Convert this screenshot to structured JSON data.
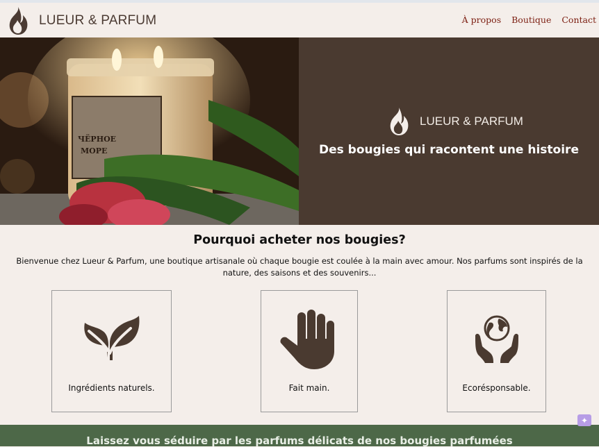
{
  "header": {
    "brand": "LUEUR & PARFUM",
    "nav": [
      "À propos",
      "Boutique",
      "Contact"
    ]
  },
  "hero": {
    "brand": "LUEUR & PARFUM",
    "tagline": "Des bougies qui racontent une histoire",
    "jar_text": [
      "ЧЁРНОЕ",
      "МОРЕ"
    ]
  },
  "why": {
    "title": "Pourquoi acheter nos bougies?",
    "text": "Bienvenue chez Lueur & Parfum, une boutique artisanale où chaque bougie est coulée à la main avec amour. Nos parfums sont inspirés de la nature, des saisons et des souvenirs..."
  },
  "features": [
    {
      "label": "Ingrédients naturels.",
      "icon": "leaf-icon"
    },
    {
      "label": "Fait main.",
      "icon": "hand-icon"
    },
    {
      "label": "Ecorésponsable.",
      "icon": "earth-hands-icon"
    }
  ],
  "footer": {
    "text": "Laissez vous séduire par les parfums délicats de nos bougies parfumées"
  },
  "colors": {
    "background": "#f4eeea",
    "brown": "#4a3a30",
    "nav_link": "#7b1d10",
    "green_band": "#4d6848"
  }
}
